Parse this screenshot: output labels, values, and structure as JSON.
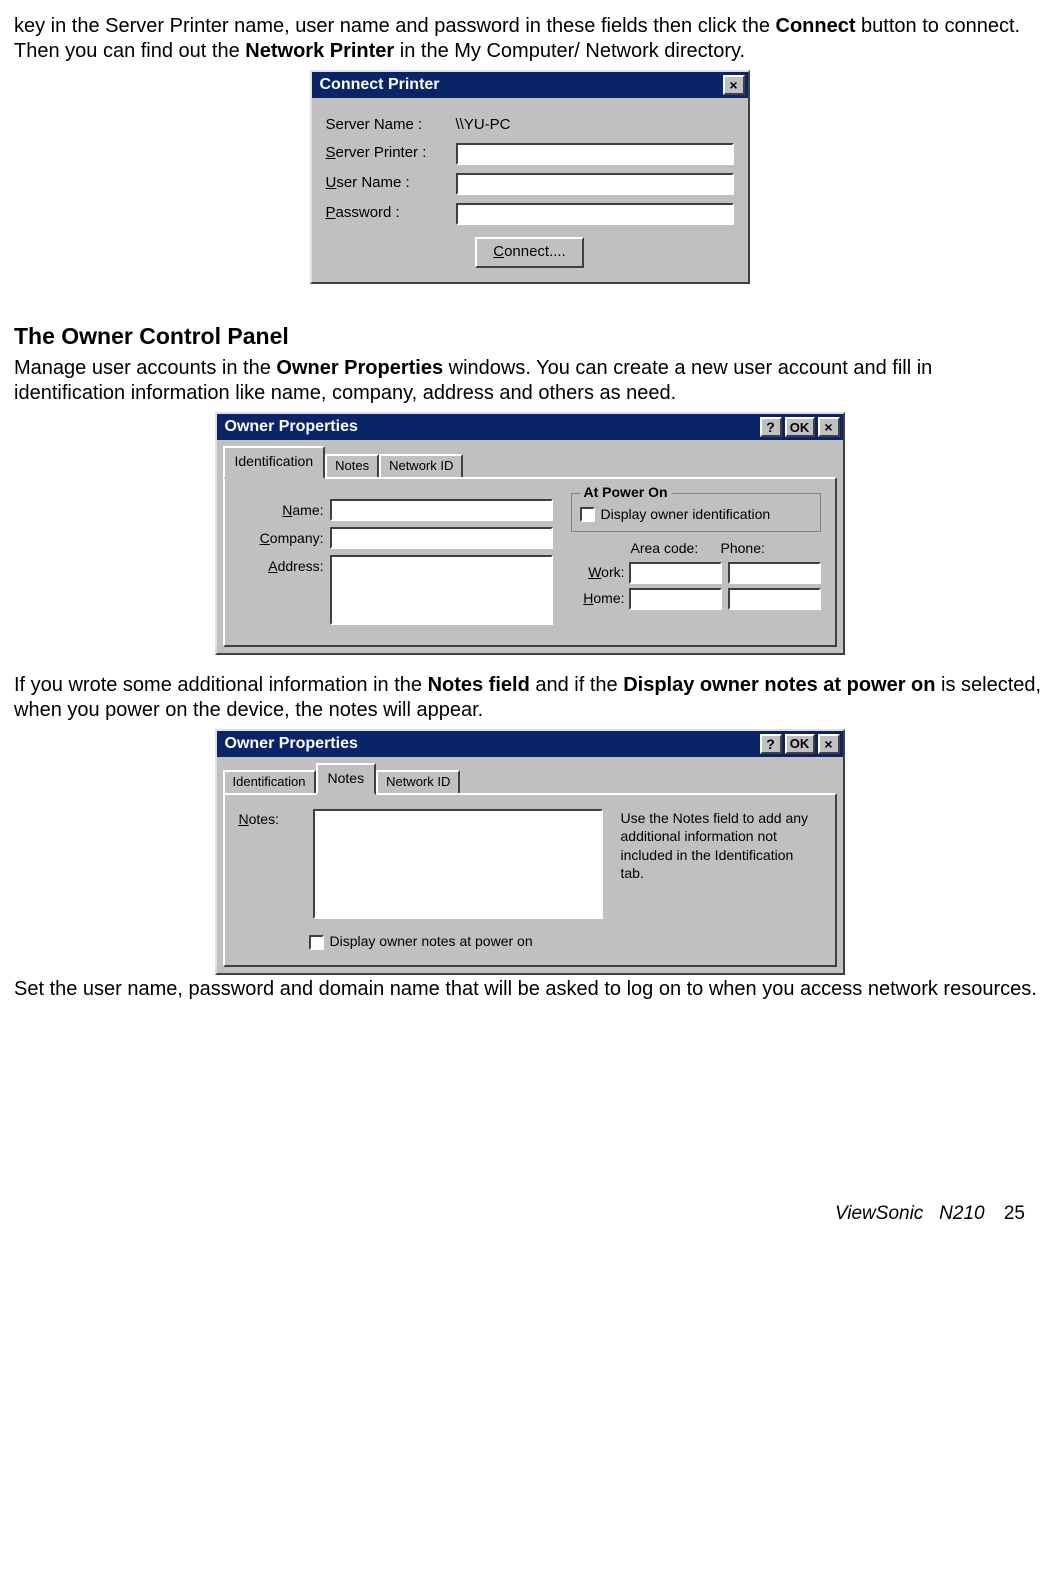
{
  "paragraphs": {
    "intro_part1": "key in the Server Printer name, user name and password in these fields then click the ",
    "intro_bold1": "Connect",
    "intro_part2": " button to connect. Then you can find out the ",
    "intro_bold2": "Network Printer",
    "intro_part3": " in the My Computer/ Network directory.",
    "owner_heading": "The Owner Control Panel",
    "owner_para_part1": "Manage user accounts in the ",
    "owner_para_bold1": "Owner Properties",
    "owner_para_part2": " windows. You can create a new user account and fill in identification information like name, company, address and others as need.",
    "notes_para_part1": "If you wrote some additional information in the ",
    "notes_para_bold1": "Notes field",
    "notes_para_part2": " and if the ",
    "notes_para_bold2": "Display owner notes at power on",
    "notes_para_part3": " is selected, when you power on the device, the notes will appear.",
    "final_para": "Set the user name, password and domain name that will be asked to log on to when you access network resources."
  },
  "dialog1": {
    "title": "Connect Printer",
    "close": "×",
    "server_name_label_pre": "Server Name :",
    "server_name_value": "\\\\YU-PC",
    "server_printer_label_letter": "S",
    "server_printer_label_rest": "erver Printer :",
    "user_name_label_letter": "U",
    "user_name_label_rest": "ser Name :",
    "password_label_letter": "P",
    "password_label_rest": "assword :",
    "connect_btn_letter": "C",
    "connect_btn_rest": "onnect...."
  },
  "dialog2": {
    "title": "Owner Properties",
    "help": "?",
    "ok": "OK",
    "close": "×",
    "tabs": {
      "identification": "Identification",
      "notes": "Notes",
      "network": "Network ID"
    },
    "labels": {
      "name_u": "N",
      "name_r": "ame:",
      "company_u": "C",
      "company_r": "ompany:",
      "address_u": "A",
      "address_r": "ddress:",
      "work_u": "W",
      "work_r": "ork:",
      "home_u": "H",
      "home_r": "ome:"
    },
    "group_title": "At Power On",
    "checkbox_label": "Display owner identification",
    "area_code": "Area code:",
    "phone": "Phone:"
  },
  "dialog3": {
    "title": "Owner Properties",
    "help": "?",
    "ok": "OK",
    "close": "×",
    "tabs": {
      "identification": "Identification",
      "notes": "Notes",
      "network": "Network ID"
    },
    "notes_label_u": "N",
    "notes_label_r": "otes:",
    "hint": "Use the Notes field to add any additional information not included in the Identification tab.",
    "checkbox_label": "Display owner notes at power on"
  },
  "footer": {
    "brand": "ViewSonic",
    "model": "N210",
    "page": "25"
  }
}
